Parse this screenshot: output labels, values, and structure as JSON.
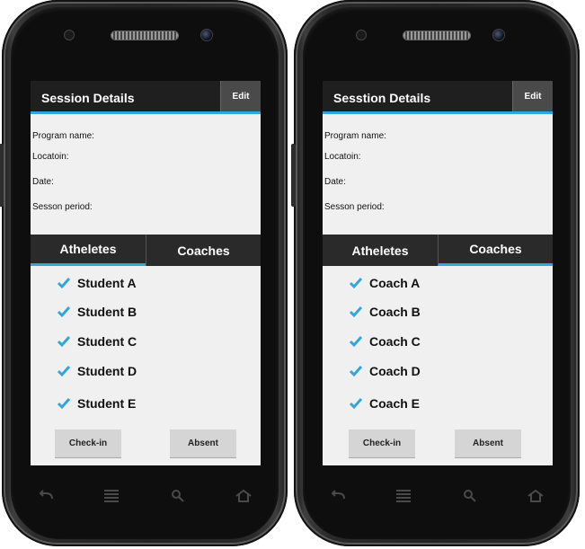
{
  "phones": [
    {
      "header": {
        "title": "Session Details",
        "edit_label": "Edit"
      },
      "fields": [
        "Program name:",
        "Locatoin:",
        "Date:",
        "Sesson period:"
      ],
      "tabs": [
        {
          "label": "Atheletes",
          "active": true
        },
        {
          "label": "Coaches",
          "active": false
        }
      ],
      "list": [
        "Student A",
        "Student B",
        "Student C",
        "Student D",
        "Student E"
      ],
      "buttons": {
        "checkin": "Check-in",
        "absent": "Absent"
      }
    },
    {
      "header": {
        "title": "Sesstion Details",
        "edit_label": "Edit"
      },
      "fields": [
        "Program name:",
        "Locatoin:",
        "Date:",
        "Sesson period:"
      ],
      "tabs": [
        {
          "label": "Atheletes",
          "active": false
        },
        {
          "label": "Coaches",
          "active": true
        }
      ],
      "list": [
        "Coach A",
        "Coach B",
        "Coach C",
        "Coach D",
        "Coach E"
      ],
      "buttons": {
        "checkin": "Check-in",
        "absent": "Absent"
      }
    }
  ],
  "colors": {
    "accent": "#33a5d8",
    "header_bg": "#1f1f1f",
    "screen_bg": "#f0f0f0",
    "button_bg": "#d5d5d5"
  },
  "icons": {
    "check": "checkmark-icon",
    "nav": [
      "back-icon",
      "menu-icon",
      "search-icon",
      "home-icon"
    ]
  }
}
